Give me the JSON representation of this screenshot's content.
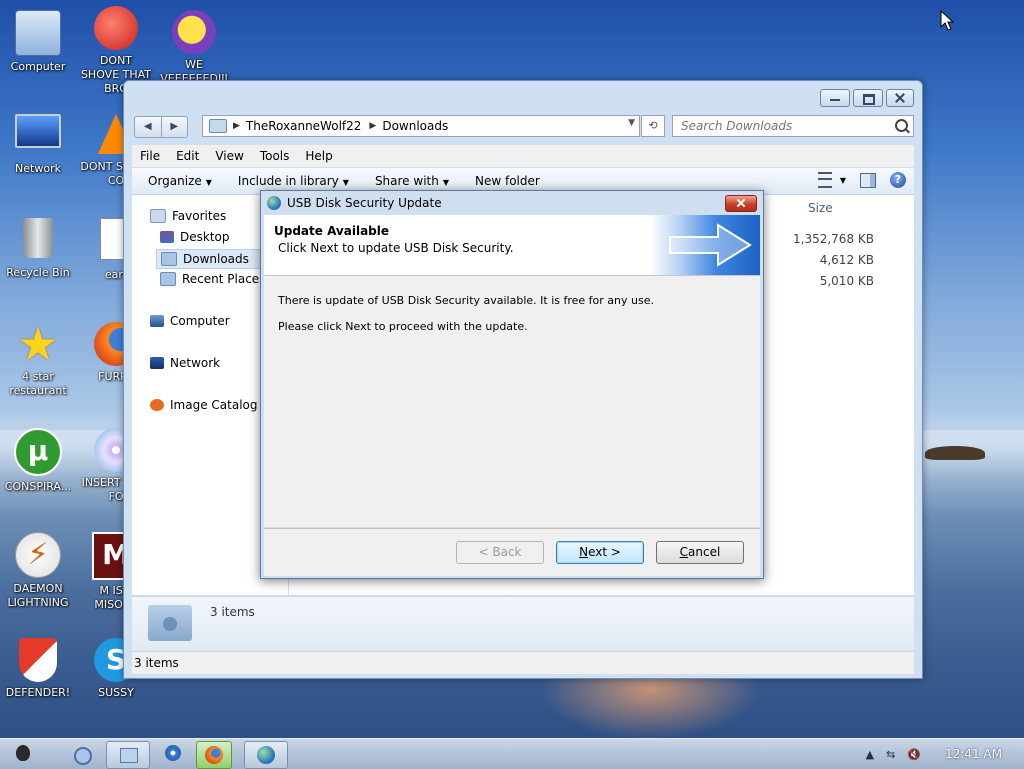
{
  "desktop": {
    "icons": [
      {
        "label": "Computer"
      },
      {
        "label": "DONT SHOVE THAT BRO"
      },
      {
        "label": "WE VEEEEEEDIII"
      },
      {
        "label": "Network"
      },
      {
        "label": "DONT S THIS CO"
      },
      {
        "label": "Recycle Bin"
      },
      {
        "label": "eart"
      },
      {
        "label": "4 star restaurant"
      },
      {
        "label": "FURRY"
      },
      {
        "label": "CONSPIRA..."
      },
      {
        "label": "INSERT DISC FO"
      },
      {
        "label": "DAEMON LIGHTNING"
      },
      {
        "label": "M IS F MISOPH"
      },
      {
        "label": "DEFENDER!"
      },
      {
        "label": "SUSSY"
      }
    ]
  },
  "explorer": {
    "breadcrumb": [
      "TheRoxanneWolf22",
      "Downloads"
    ],
    "search_placeholder": "Search Downloads",
    "menu": [
      "File",
      "Edit",
      "View",
      "Tools",
      "Help"
    ],
    "toolbar": {
      "organize": "Organize",
      "include": "Include in library",
      "share": "Share with",
      "new_folder": "New folder"
    },
    "nav": {
      "favorites": "Favorites",
      "desktop": "Desktop",
      "downloads": "Downloads",
      "recent": "Recent Places",
      "computer": "Computer",
      "network": "Network",
      "image_catalog": "Image Catalog"
    },
    "size_header": "Size",
    "sizes": [
      "1,352,768 KB",
      "4,612 KB",
      "5,010 KB"
    ],
    "details_count": "3 items",
    "status": "3 items"
  },
  "dialog": {
    "title": "USB Disk Security Update",
    "heading": "Update Available",
    "subheading": "Click Next to update USB Disk Security.",
    "body_line1": "There is update of USB Disk Security available. It is free for any use.",
    "body_line2": "Please click Next to proceed with the update.",
    "back": "< Back",
    "next_prefix": "N",
    "next_rest": "ext >",
    "cancel_prefix": "C",
    "cancel_rest": "ancel"
  },
  "taskbar": {
    "clock": "12:41 AM"
  },
  "colors": {
    "accent": "#3c7fb1",
    "close_red": "#c8412a"
  }
}
